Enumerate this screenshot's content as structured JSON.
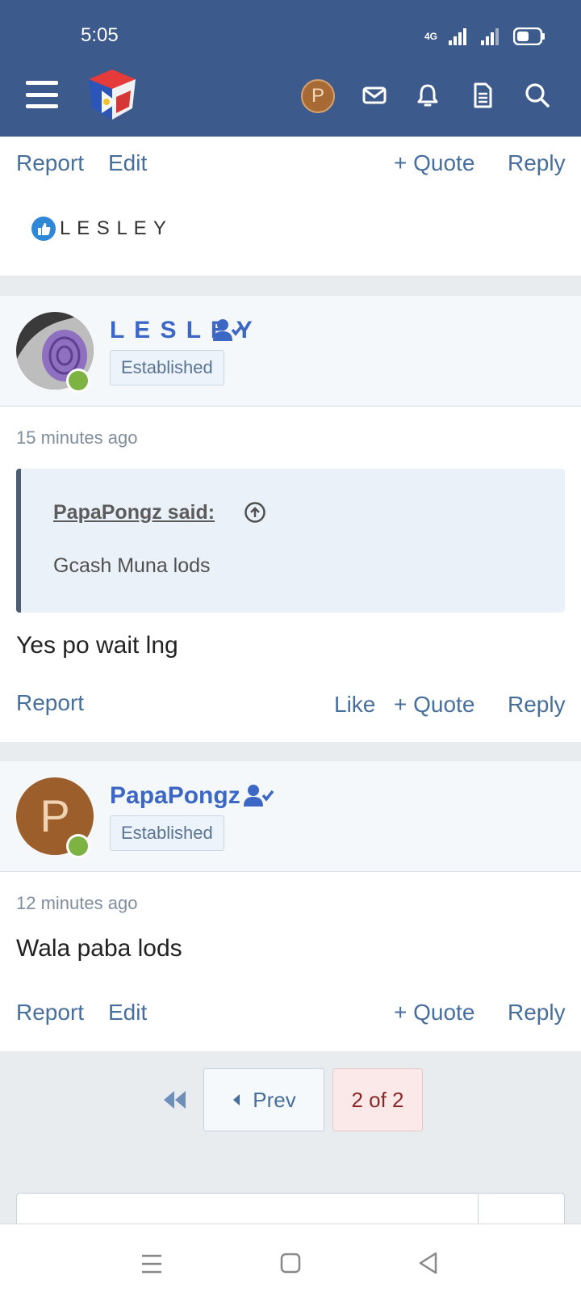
{
  "status_bar": {
    "time": "5:05",
    "network": "4G"
  },
  "header": {
    "user_initial": "P"
  },
  "post_prev": {
    "actions_left": [
      "Report",
      "Edit"
    ],
    "quote": "+ Quote",
    "reply": "Reply",
    "liked_by": "L E S L E Y"
  },
  "post_lesley": {
    "username": "L E S L E Y",
    "badge": "Established",
    "time": "15 minutes ago",
    "quote_author": "PapaPongz said:",
    "quote_text": "Gcash Muna lods",
    "message": "Yes po wait lng",
    "report": "Report",
    "like": "Like",
    "quote": "+ Quote",
    "reply": "Reply"
  },
  "post_papa": {
    "avatar_initial": "P",
    "username": "PapaPongz",
    "badge": "Established",
    "time": "12 minutes ago",
    "message": "Wala paba lods",
    "report": "Report",
    "edit": "Edit",
    "quote": "+ Quote",
    "reply": "Reply"
  },
  "pagination": {
    "prev": "Prev",
    "current": "2 of 2"
  },
  "colors": {
    "header_bg": "#3d5a8c",
    "link": "#476f9e",
    "username": "#3d67c4",
    "online": "#7cb342"
  }
}
